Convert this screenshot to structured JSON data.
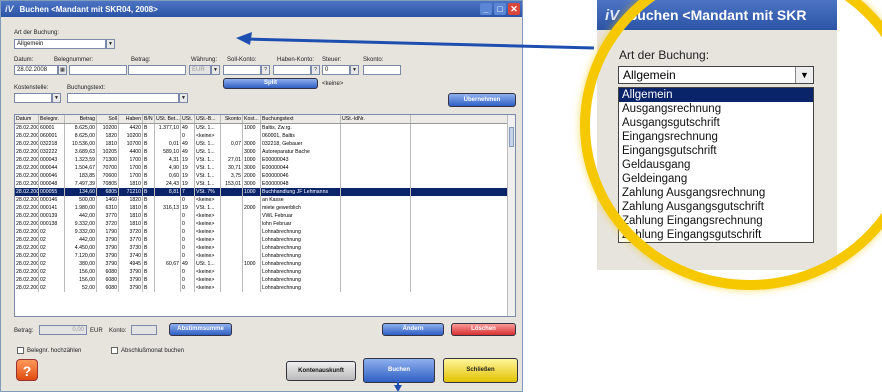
{
  "window": {
    "title": "Buchen <Mandant mit SKR04, 2008>",
    "logo": "iV"
  },
  "form": {
    "art_label": "Art der Buchung:",
    "art_value": "Allgemein",
    "datum_label": "Datum:",
    "datum_value": "28.02.2008",
    "belegnummer_label": "Belegnummer:",
    "betrag_label": "Betrag:",
    "waehrung_label": "Währung:",
    "waehrung_value": "EUR",
    "soll_label": "Soll-Konto:",
    "haben_label": "Haben-Konto:",
    "steuer_label": "Steuer:",
    "steuer_value": "0",
    "skonto_label": "Skonto:",
    "kostenstelle_label": "Kostenstelle:",
    "buchungstext_label": "Buchungstext:",
    "split_label": "Split",
    "keine_label": "<keine>",
    "uebernehmen_label": "Übernehmen"
  },
  "grid": {
    "headers": [
      "Datum",
      "Belegnr.",
      "Betrag",
      "Soll",
      "Haben",
      "B/N",
      "USt. Bet...",
      "USt.",
      "USt.-B...",
      "Skonto",
      "Kost...",
      "Buchungstext",
      "USt.-IdNr."
    ],
    "rows": [
      [
        "28.02.2008",
        "60001",
        "8.625,00",
        "10200",
        "4420",
        "B",
        "1.377,10",
        "49",
        "USt. 1...",
        "",
        "1000",
        "Baltis, Zw.rg.",
        ""
      ],
      [
        "28.02.2008",
        "060001",
        "8.625,00",
        "1820",
        "10200",
        "B",
        "",
        "0",
        "<keine>",
        "",
        "",
        "060001, Baltis",
        ""
      ],
      [
        "28.02.2008",
        "032218",
        "10.536,00",
        "1810",
        "10700",
        "B",
        "0,01",
        "49",
        "USt. 1...",
        "0,07",
        "3000",
        "032218, Gebauer",
        ""
      ],
      [
        "28.02.2008",
        "032222",
        "3.689,63",
        "10205",
        "4400",
        "B",
        "589,10",
        "49",
        "USt. 1...",
        "",
        "3000",
        "Autoreparatur Bache",
        ""
      ],
      [
        "28.02.2008",
        "000043",
        "1.323,59",
        "71300",
        "1700",
        "B",
        "4,31",
        "19",
        "VSt. 1...",
        "27,01",
        "1000",
        "E00000043",
        ""
      ],
      [
        "28.02.2008",
        "000044",
        "1.504,67",
        "70700",
        "1700",
        "B",
        "4,90",
        "19",
        "VSt. 1...",
        "30,71",
        "3000",
        "E00000044",
        ""
      ],
      [
        "28.02.2008",
        "000046",
        "183,85",
        "70600",
        "1700",
        "B",
        "0,60",
        "19",
        "VSt. 1...",
        "3,75",
        "2000",
        "E00000046",
        ""
      ],
      [
        "28.02.2008",
        "000048",
        "7.497,39",
        "70805",
        "1810",
        "B",
        "24,43",
        "19",
        "VSt. 1...",
        "153,01",
        "3000",
        "E00000048",
        ""
      ],
      [
        "28.02.2008",
        "000055",
        "134,60",
        "6805",
        "71210",
        "B",
        "8,81",
        "7",
        "VSt. 7%",
        "",
        "1000",
        "Buchhandlung JF Lehmanns",
        ""
      ],
      [
        "28.02.2008",
        "000146",
        "500,00",
        "1460",
        "1820",
        "B",
        "",
        "0",
        "<keine>",
        "",
        "",
        "an Kasse",
        ""
      ],
      [
        "28.02.2008",
        "000141",
        "1.980,00",
        "6310",
        "1810",
        "B",
        "316,13",
        "19",
        "VSt. 1...",
        "",
        "2000",
        "miete gewerblich",
        ""
      ],
      [
        "28.02.2008",
        "000139",
        "442,00",
        "3770",
        "1810",
        "B",
        "",
        "0",
        "<keine>",
        "",
        "",
        "VWL Februar",
        ""
      ],
      [
        "28.02.2008",
        "000138",
        "9.332,00",
        "3720",
        "1810",
        "B",
        "",
        "0",
        "<keine>",
        "",
        "",
        "lohn Februar",
        ""
      ],
      [
        "28.02.2008",
        "02",
        "9.332,00",
        "1790",
        "3720",
        "B",
        "",
        "0",
        "<keine>",
        "",
        "",
        "Lohnabrechnung",
        ""
      ],
      [
        "28.02.2008",
        "02",
        "442,00",
        "3790",
        "3770",
        "B",
        "",
        "0",
        "<keine>",
        "",
        "",
        "Lohnabrechnung",
        ""
      ],
      [
        "28.02.2008",
        "02",
        "4.450,00",
        "3790",
        "3730",
        "B",
        "",
        "0",
        "<keine>",
        "",
        "",
        "Lohnabrechnung",
        ""
      ],
      [
        "28.02.2008",
        "02",
        "7.120,00",
        "3790",
        "3740",
        "B",
        "",
        "0",
        "<keine>",
        "",
        "",
        "Lohnabrechnung",
        ""
      ],
      [
        "28.02.2008",
        "02",
        "380,00",
        "3790",
        "4945",
        "B",
        "60,67",
        "49",
        "USt. 1...",
        "",
        "1000",
        "Lohnabrechnung",
        ""
      ],
      [
        "28.02.2008",
        "02",
        "156,00",
        "6080",
        "3790",
        "B",
        "",
        "0",
        "<keine>",
        "",
        "",
        "Lohnabrechnung",
        ""
      ],
      [
        "28.02.2008",
        "02",
        "156,00",
        "6080",
        "3790",
        "B",
        "",
        "0",
        "<keine>",
        "",
        "",
        "Lohnabrechnung",
        ""
      ],
      [
        "28.02.2008",
        "02",
        "52,00",
        "6080",
        "3790",
        "B",
        "",
        "0",
        "<keine>",
        "",
        "",
        "Lohnabrechnung",
        ""
      ]
    ],
    "selected_row": 8
  },
  "footer": {
    "betrag_label": "Betrag:",
    "betrag_value": "0,00",
    "currency": "EUR",
    "konto_label": "Konto:",
    "abstimmsumme_label": "Abstimmsumme",
    "aendern_label": "Ändern",
    "loeschen_label": "Löschen",
    "belegnr_checkbox_label": "Belegnr. hochzählen",
    "abschluss_checkbox_label": "Abschlußmonat buchen",
    "help_label": "?",
    "kontenauskunft_label": "Kontenauskunft",
    "buchen_label": "Buchen",
    "schliessen_label": "Schließen"
  },
  "zoom": {
    "title": "Buchen <Mandant mit SKR",
    "logo": "iV",
    "label": "Art der Buchung:",
    "selected": "Allgemein",
    "options": [
      "Allgemein",
      "Ausgangsrechnung",
      "Ausgangsgutschrift",
      "Eingangsrechnung",
      "Eingangsgutschrift",
      "Geldausgang",
      "Geldeingang",
      "Zahlung Ausgangsrechnung",
      "Zahlung Ausgangsgutschrift",
      "Zahlung Eingangsrechnung",
      "Zahlung Eingangsgutschrift"
    ]
  },
  "colors": {
    "accent": "#f5c800",
    "title_blue": "#2b54a6",
    "selection": "#0a246a"
  }
}
